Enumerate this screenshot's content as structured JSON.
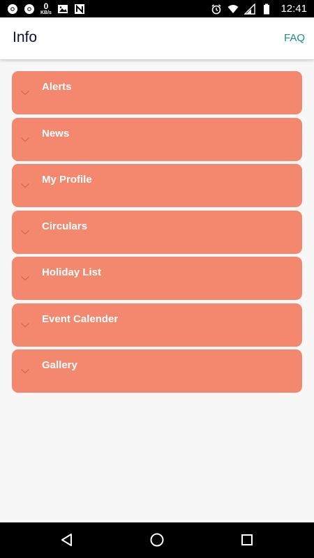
{
  "status_bar": {
    "left_icons": [
      "chrome-icon",
      "chrome-icon",
      "image-icon",
      "n-icon"
    ],
    "net_speed_value": "0",
    "net_speed_unit": "KB/s",
    "right_icons": [
      "alarm-icon",
      "wifi-icon",
      "signal-icon",
      "battery-icon"
    ],
    "time": "12:41"
  },
  "app_bar": {
    "title": "Info",
    "faq_label": "FAQ"
  },
  "menu": {
    "items": [
      {
        "label": "Alerts"
      },
      {
        "label": "News"
      },
      {
        "label": "My Profile"
      },
      {
        "label": "Circulars"
      },
      {
        "label": "Holiday List"
      },
      {
        "label": "Event Calender"
      },
      {
        "label": "Gallery"
      }
    ]
  },
  "nav_bar": {
    "buttons": [
      "back-icon",
      "home-icon",
      "recents-icon"
    ]
  },
  "colors": {
    "accent_card": "#f4886f",
    "faq_link": "#1a8a8f",
    "title_text": "#0f0f2e",
    "page_background": "#f7f7f7"
  }
}
